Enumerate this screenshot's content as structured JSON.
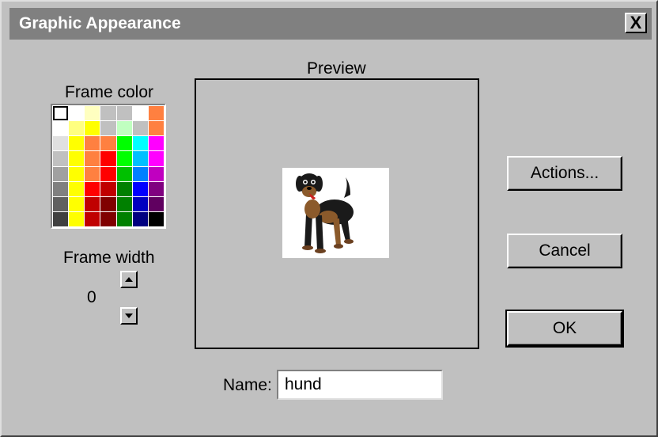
{
  "window": {
    "title": "Graphic Appearance",
    "close_label": "X"
  },
  "frame_color": {
    "label": "Frame color",
    "palette": [
      [
        "#ffffff",
        "#ffffff",
        "#ffffc0",
        "#c0c0c0",
        "#c0c0c0",
        "#ffffff",
        "#ff8040"
      ],
      [
        "#ffffff",
        "#ffff80",
        "#ffff00",
        "#c0c0c0",
        "#c0ffc0",
        "#c0c0c0",
        "#ff8040"
      ],
      [
        "#e0e0e0",
        "#ffff00",
        "#ff8040",
        "#ff8040",
        "#00ff00",
        "#00ffff",
        "#ff00ff"
      ],
      [
        "#c0c0c0",
        "#ffff00",
        "#ff8040",
        "#ff0000",
        "#00ff00",
        "#00c0ff",
        "#ff00ff"
      ],
      [
        "#a0a0a0",
        "#ffff00",
        "#ff8040",
        "#ff0000",
        "#00c000",
        "#0080ff",
        "#c000c0"
      ],
      [
        "#808080",
        "#ffff00",
        "#ff0000",
        "#c00000",
        "#008000",
        "#0000ff",
        "#800080"
      ],
      [
        "#606060",
        "#ffff00",
        "#c00000",
        "#800000",
        "#008000",
        "#0000c0",
        "#600060"
      ],
      [
        "#404040",
        "#ffff00",
        "#c00000",
        "#800000",
        "#008000",
        "#000080",
        "#000000"
      ]
    ],
    "selected_swatch": "#ffffff"
  },
  "frame_width": {
    "label": "Frame width",
    "value": "0"
  },
  "preview": {
    "label": "Preview"
  },
  "buttons": {
    "actions": "Actions...",
    "cancel": "Cancel",
    "ok": "OK"
  },
  "name_field": {
    "label": "Name:",
    "value": "hund"
  }
}
